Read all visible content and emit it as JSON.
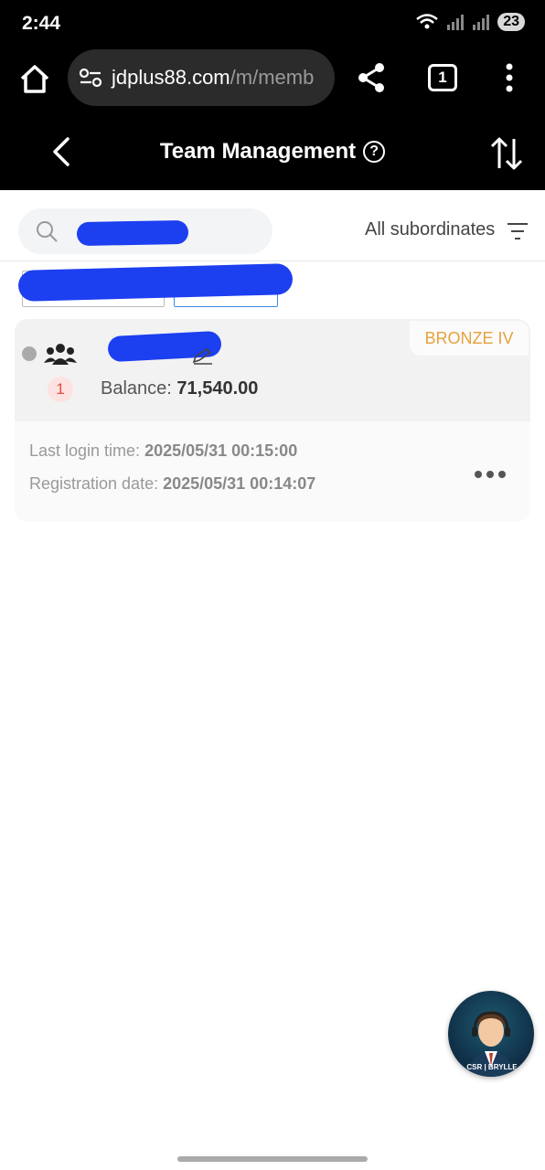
{
  "status_bar": {
    "time": "2:44",
    "battery": "23"
  },
  "browser": {
    "url_host": "jdplus88.com",
    "url_path": "/m/memb",
    "tab_count": "1"
  },
  "header": {
    "title": "Team Management",
    "help_symbol": "?"
  },
  "search": {
    "value": "",
    "placeholder": ""
  },
  "filter": {
    "label": "All subordinates"
  },
  "member": {
    "rank": "BRONZE IV",
    "level": "1",
    "balance_label": "Balance: ",
    "balance_value": "71,540.00",
    "last_login_label": "Last login time: ",
    "last_login_value": "2025/05/31 00:15:00",
    "registration_label": "Registration date: ",
    "registration_value": "2025/05/31 00:14:07"
  },
  "support": {
    "label": "CSR | BRYLLE"
  },
  "colors": {
    "rank_color": "#e6a23c",
    "level_color": "#e74c3c",
    "chip_accent": "#3a8ee6",
    "redaction": "#1c3ff0"
  },
  "icons": [
    "home-icon",
    "site-settings-icon",
    "share-icon",
    "tabs-icon",
    "more-vert-icon",
    "back-icon",
    "help-icon",
    "sort-icon",
    "search-icon",
    "filter-icon",
    "team-icon",
    "edit-icon",
    "more-horiz-icon"
  ]
}
